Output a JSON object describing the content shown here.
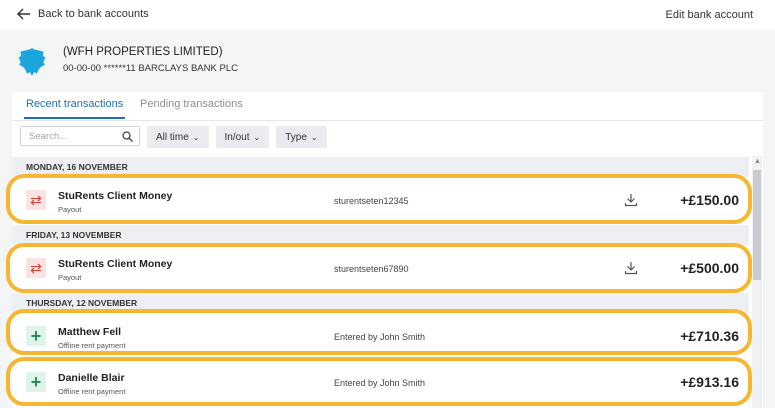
{
  "header": {
    "back_label": "Back to bank accounts",
    "edit_label": "Edit bank account"
  },
  "account": {
    "name": "(WFH PROPERTIES LIMITED)",
    "details": "00-00-00 ******11 BARCLAYS BANK PLC"
  },
  "tabs": [
    {
      "label": "Recent transactions",
      "active": true
    },
    {
      "label": "Pending transactions",
      "active": false
    }
  ],
  "filters": {
    "search_placeholder": "Search...",
    "time": "All time",
    "direction": "In/out",
    "type": "Type"
  },
  "groups": [
    {
      "date": "MONDAY, 16 NOVEMBER",
      "transactions": [
        {
          "name": "StuRents Client Money",
          "type": "Payout",
          "reference": "sturentseten12345",
          "amount": "+£150.00",
          "icon": "transfer-icon",
          "downloadable": true
        }
      ]
    },
    {
      "date": "FRIDAY, 13 NOVEMBER",
      "transactions": [
        {
          "name": "StuRents Client Money",
          "type": "Payout",
          "reference": "sturentseten67890",
          "amount": "+£500.00",
          "icon": "transfer-icon",
          "downloadable": true
        }
      ]
    },
    {
      "date": "THURSDAY, 12 NOVEMBER",
      "transactions": [
        {
          "name": "Matthew Fell",
          "type": "Offline rent payment",
          "reference": "Entered by John Smith",
          "amount": "+£710.36",
          "icon": "plus-icon",
          "downloadable": false
        },
        {
          "name": "Danielle Blair",
          "type": "Offline rent payment",
          "reference": "Entered by John Smith",
          "amount": "+£913.16",
          "icon": "plus-icon",
          "downloadable": false
        }
      ]
    }
  ],
  "colors": {
    "accent": "#1f6fb5",
    "highlight": "#f5b731",
    "transfer_icon": "#d2413a",
    "plus_icon": "#2b8a5c"
  }
}
